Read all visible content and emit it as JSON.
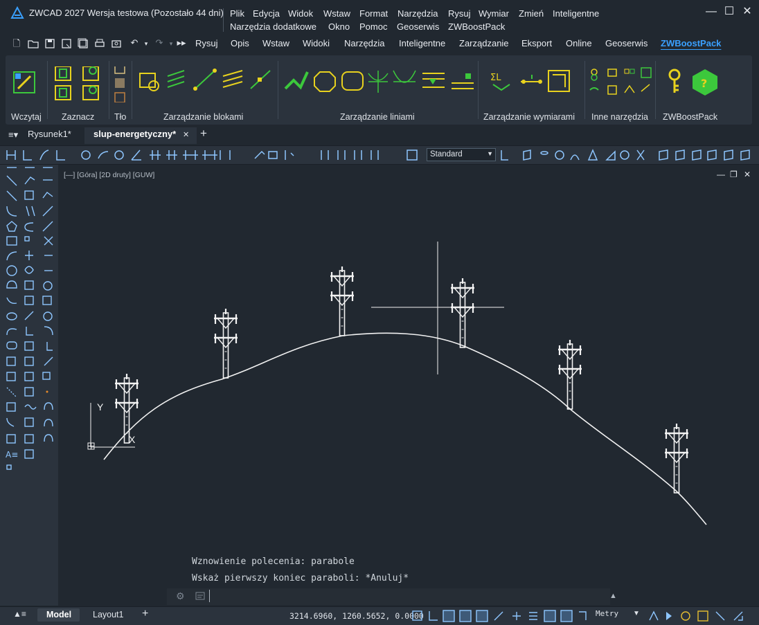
{
  "app": {
    "title": "ZWCAD 2027 Wersja testowa (Pozostało 44 dni)",
    "menu_row1": [
      "Plik",
      "Edycja",
      "Widok",
      "Wstaw",
      "Format",
      "Narzędzia",
      "Rysuj",
      "Wymiar",
      "Zmień",
      "Inteligentne"
    ],
    "menu_row2": [
      "Narzędzia dodatkowe",
      "Okno",
      "Pomoc",
      "Geoserwis",
      "ZWBoostPack"
    ]
  },
  "ribbon_tabs": [
    "Rysuj",
    "Opis",
    "Wstaw",
    "Widoki",
    "Narzędzia",
    "Inteligentne",
    "Zarządzanie",
    "Eksport",
    "Online",
    "Geoserwis",
    "ZWBoostPack"
  ],
  "active_tab": "ZWBoostPack",
  "ribbon_groups": [
    "Wczytaj",
    "Zaznacz",
    "Tło",
    "Zarządzanie blokami",
    "Zarządzanie liniami",
    "Zarządzanie wymiarami",
    "Inne narzędzia",
    "ZWBoostPack"
  ],
  "doc_tabs": {
    "tab1": "Rysunek1*",
    "tab2": "slup-energetyczny*",
    "close": "✕",
    "add": "+"
  },
  "style_select": "Standard",
  "viewport": {
    "label": "[—] [Góra] [2D druty] [GUW]",
    "minimize": "—",
    "restore": "❐",
    "close": "✕"
  },
  "ucs": {
    "x_label": "X",
    "y_label": "Y"
  },
  "command": {
    "line1": "Wznowienie polecenia: parabole",
    "line2": "Wskaż pierwszy koniec paraboli: *Anuluj*"
  },
  "status": {
    "tab_model": "Model",
    "tab_layout": "Layout1",
    "add": "+",
    "coords": "3214.6960, 1260.5652, 0.0000",
    "units": "Metry"
  },
  "colors": {
    "accent": "#3aa0ff",
    "ribbon_green": "#3cc83c",
    "ribbon_yellow": "#e8d21e",
    "canvas_bg": "#212830"
  }
}
